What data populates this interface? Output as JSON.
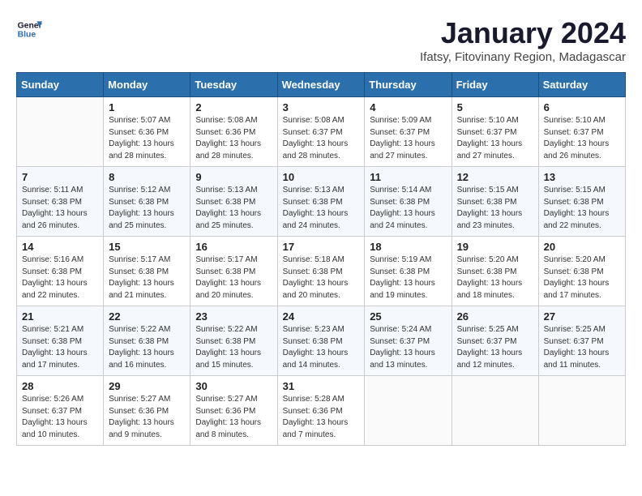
{
  "logo": {
    "line1": "General",
    "line2": "Blue"
  },
  "title": "January 2024",
  "location": "Ifatsy, Fitovinany Region, Madagascar",
  "weekdays": [
    "Sunday",
    "Monday",
    "Tuesday",
    "Wednesday",
    "Thursday",
    "Friday",
    "Saturday"
  ],
  "weeks": [
    [
      {
        "day": "",
        "info": ""
      },
      {
        "day": "1",
        "info": "Sunrise: 5:07 AM\nSunset: 6:36 PM\nDaylight: 13 hours\nand 28 minutes."
      },
      {
        "day": "2",
        "info": "Sunrise: 5:08 AM\nSunset: 6:36 PM\nDaylight: 13 hours\nand 28 minutes."
      },
      {
        "day": "3",
        "info": "Sunrise: 5:08 AM\nSunset: 6:37 PM\nDaylight: 13 hours\nand 28 minutes."
      },
      {
        "day": "4",
        "info": "Sunrise: 5:09 AM\nSunset: 6:37 PM\nDaylight: 13 hours\nand 27 minutes."
      },
      {
        "day": "5",
        "info": "Sunrise: 5:10 AM\nSunset: 6:37 PM\nDaylight: 13 hours\nand 27 minutes."
      },
      {
        "day": "6",
        "info": "Sunrise: 5:10 AM\nSunset: 6:37 PM\nDaylight: 13 hours\nand 26 minutes."
      }
    ],
    [
      {
        "day": "7",
        "info": "Sunrise: 5:11 AM\nSunset: 6:38 PM\nDaylight: 13 hours\nand 26 minutes."
      },
      {
        "day": "8",
        "info": "Sunrise: 5:12 AM\nSunset: 6:38 PM\nDaylight: 13 hours\nand 25 minutes."
      },
      {
        "day": "9",
        "info": "Sunrise: 5:13 AM\nSunset: 6:38 PM\nDaylight: 13 hours\nand 25 minutes."
      },
      {
        "day": "10",
        "info": "Sunrise: 5:13 AM\nSunset: 6:38 PM\nDaylight: 13 hours\nand 24 minutes."
      },
      {
        "day": "11",
        "info": "Sunrise: 5:14 AM\nSunset: 6:38 PM\nDaylight: 13 hours\nand 24 minutes."
      },
      {
        "day": "12",
        "info": "Sunrise: 5:15 AM\nSunset: 6:38 PM\nDaylight: 13 hours\nand 23 minutes."
      },
      {
        "day": "13",
        "info": "Sunrise: 5:15 AM\nSunset: 6:38 PM\nDaylight: 13 hours\nand 22 minutes."
      }
    ],
    [
      {
        "day": "14",
        "info": "Sunrise: 5:16 AM\nSunset: 6:38 PM\nDaylight: 13 hours\nand 22 minutes."
      },
      {
        "day": "15",
        "info": "Sunrise: 5:17 AM\nSunset: 6:38 PM\nDaylight: 13 hours\nand 21 minutes."
      },
      {
        "day": "16",
        "info": "Sunrise: 5:17 AM\nSunset: 6:38 PM\nDaylight: 13 hours\nand 20 minutes."
      },
      {
        "day": "17",
        "info": "Sunrise: 5:18 AM\nSunset: 6:38 PM\nDaylight: 13 hours\nand 20 minutes."
      },
      {
        "day": "18",
        "info": "Sunrise: 5:19 AM\nSunset: 6:38 PM\nDaylight: 13 hours\nand 19 minutes."
      },
      {
        "day": "19",
        "info": "Sunrise: 5:20 AM\nSunset: 6:38 PM\nDaylight: 13 hours\nand 18 minutes."
      },
      {
        "day": "20",
        "info": "Sunrise: 5:20 AM\nSunset: 6:38 PM\nDaylight: 13 hours\nand 17 minutes."
      }
    ],
    [
      {
        "day": "21",
        "info": "Sunrise: 5:21 AM\nSunset: 6:38 PM\nDaylight: 13 hours\nand 17 minutes."
      },
      {
        "day": "22",
        "info": "Sunrise: 5:22 AM\nSunset: 6:38 PM\nDaylight: 13 hours\nand 16 minutes."
      },
      {
        "day": "23",
        "info": "Sunrise: 5:22 AM\nSunset: 6:38 PM\nDaylight: 13 hours\nand 15 minutes."
      },
      {
        "day": "24",
        "info": "Sunrise: 5:23 AM\nSunset: 6:38 PM\nDaylight: 13 hours\nand 14 minutes."
      },
      {
        "day": "25",
        "info": "Sunrise: 5:24 AM\nSunset: 6:37 PM\nDaylight: 13 hours\nand 13 minutes."
      },
      {
        "day": "26",
        "info": "Sunrise: 5:25 AM\nSunset: 6:37 PM\nDaylight: 13 hours\nand 12 minutes."
      },
      {
        "day": "27",
        "info": "Sunrise: 5:25 AM\nSunset: 6:37 PM\nDaylight: 13 hours\nand 11 minutes."
      }
    ],
    [
      {
        "day": "28",
        "info": "Sunrise: 5:26 AM\nSunset: 6:37 PM\nDaylight: 13 hours\nand 10 minutes."
      },
      {
        "day": "29",
        "info": "Sunrise: 5:27 AM\nSunset: 6:36 PM\nDaylight: 13 hours\nand 9 minutes."
      },
      {
        "day": "30",
        "info": "Sunrise: 5:27 AM\nSunset: 6:36 PM\nDaylight: 13 hours\nand 8 minutes."
      },
      {
        "day": "31",
        "info": "Sunrise: 5:28 AM\nSunset: 6:36 PM\nDaylight: 13 hours\nand 7 minutes."
      },
      {
        "day": "",
        "info": ""
      },
      {
        "day": "",
        "info": ""
      },
      {
        "day": "",
        "info": ""
      }
    ]
  ]
}
